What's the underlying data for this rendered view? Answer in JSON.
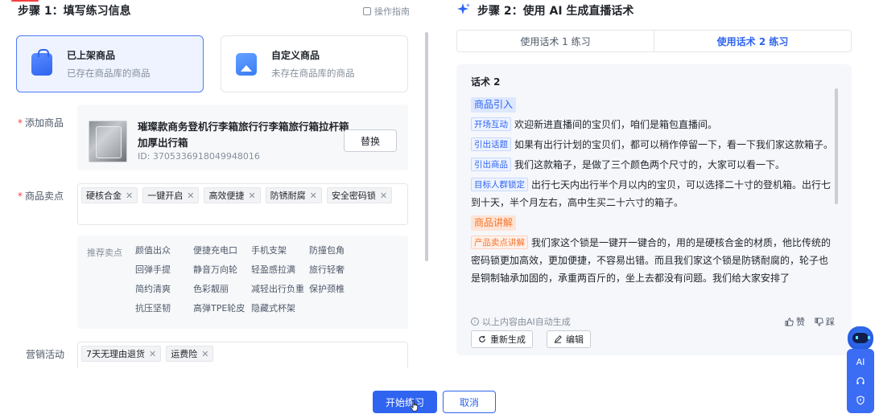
{
  "step1": {
    "title": "步骤 1：填写练习信息",
    "guide_label": "操作指南",
    "cards": [
      {
        "title": "已上架商品",
        "desc": "已存在商品库的商品",
        "icon": "shopping-bag-icon"
      },
      {
        "title": "自定义商品",
        "desc": "未存在商品库的商品",
        "icon": "image-icon"
      }
    ],
    "add_product_label": "添加商品",
    "product": {
      "name": "璀璨款商务登机行李箱旅行行李箱旅行箱拉杆箱加厚出行箱",
      "id": "ID: 3705336918049948016",
      "replace_label": "替换"
    },
    "selling_points_label": "商品卖点",
    "selling_points": [
      "硬核合金",
      "一键开启",
      "高效便捷",
      "防锈耐腐",
      "安全密码锁"
    ],
    "recommend_label": "推荐卖点",
    "recommended": [
      "颜值出众",
      "便捷充电口",
      "手机支架",
      "防撞包角",
      "回弹手提",
      "静音万向轮",
      "轻盈感拉满",
      "旅行轻奢",
      "简约清爽",
      "色彩靓丽",
      "减轻出行负重",
      "保护颈椎",
      "抗压坚韧",
      "高弹TPE轮皮",
      "隐藏式杯架"
    ],
    "marketing_label": "营销活动",
    "marketing": [
      "7天无理由退货",
      "运费险"
    ]
  },
  "step2": {
    "title": "步骤 2：使用 AI 生成直播话术",
    "tabs": [
      "使用话术 1 练习",
      "使用话术 2 练习"
    ],
    "active_tab": 1,
    "script_title": "话术 2",
    "sections": [
      {
        "heading": "商品引入",
        "color": "blue",
        "paras": [
          {
            "tag": "开场互动",
            "text": "欢迎新进直播间的宝贝们，咱们是箱包直播间。"
          },
          {
            "tag": "引出话题",
            "text": "如果有出行计划的宝贝们，都可以稍作停留一下，看一下我们家这款箱子。"
          },
          {
            "tag": "引出商品",
            "text": "我们这款箱子，是做了三个颜色两个尺寸的，大家可以看一下。"
          },
          {
            "tag": "目标人群锁定",
            "text": "出行七天内出行半个月以内的宝贝，可以选择二十寸的登机箱。出行七到十天，半个月左右，高中生买二十六寸的箱子。"
          }
        ]
      },
      {
        "heading": "商品讲解",
        "color": "orange",
        "paras": [
          {
            "tag": "产品卖点讲解",
            "text": "我们家这个锁是一键开一键合的，用的是硬核合金的材质，他比传统的密码锁更加高效，更加便捷，不容易出错。而且我们家这个锁是防锈耐腐的，轮子也是铜制轴承加固的，承重两百斤的，坐上去都没有问题。我们给大家安排了"
          }
        ]
      }
    ],
    "ai_note": "以上内容由AI自动生成",
    "like_label": "赞",
    "dislike_label": "踩",
    "regenerate_label": "重新生成",
    "edit_label": "编辑"
  },
  "float": {
    "ai_label": "AI"
  },
  "footer": {
    "start_label": "开始练习",
    "cancel_label": "取消"
  },
  "colors": {
    "primary": "#2f64f0",
    "required": "#f53f3f",
    "orange": "#f5742b"
  }
}
